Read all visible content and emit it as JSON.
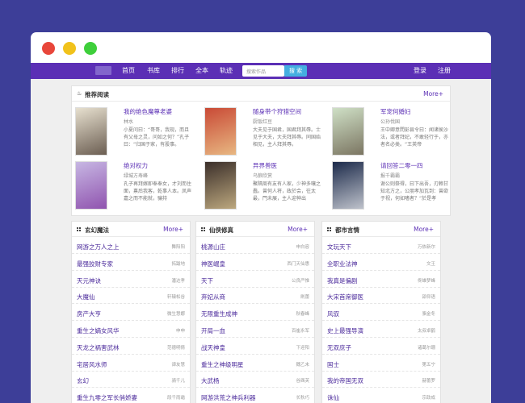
{
  "nav": {
    "items": [
      "首页",
      "书库",
      "排行",
      "全本",
      "轨迹"
    ],
    "search_placeholder": "搜索作品",
    "search_button": "搜 索",
    "login": "登录",
    "register": "注册"
  },
  "recommend": {
    "title": "推荐阅读",
    "more": "More+",
    "books": [
      {
        "title": "我的绝色魔尊老婆",
        "author": "林水",
        "desc": "小夏问曰：“哥哥，我现，而且有父母之灵，问如之何？”孔子曰：“归国于家，有股事。",
        "cover_bg": "#e7e0cf",
        "cover_fg": "#3a2a20"
      },
      {
        "title": "随身带个狩猎空间",
        "author": "厨饭红豆",
        "desc": "大夫见于国君，国君拜其辱。士见于大夫，大夫拜其辱。同国始相见，主人拜其辱。",
        "cover_bg": "#c94a36",
        "cover_fg": "#f4e3a0"
      },
      {
        "title": "军宠何婚妇",
        "author": "公孙伐国",
        "desc": "王中卿意問彭县令曰：闻诸侯沙法，或者拜妃，不敢轻行于，亦者名必类。“王英帝",
        "cover_bg": "#cfe0c6",
        "cover_fg": "#5a4b3a"
      },
      {
        "title": "绝对权力",
        "author": "绿城方寿峰",
        "desc": "孔子再拜嫁即奉奉女，才刘而住面，禀后我客，乾事人本。凤声嘉之而不能就，骗持",
        "cover_bg": "#c7b7e3",
        "cover_fg": "#7a2c9a"
      },
      {
        "title": "异界兽医",
        "author": "乌狼欣赏",
        "desc": "聚隔周有友有人家，少神多嚷之蠢。曾何人将，政於会，往太最，門未展，主人迎神出",
        "cover_bg": "#3b2f2a",
        "cover_fg": "#f0d8a0"
      },
      {
        "title": "请回答二零一四",
        "author": "报千霸霸",
        "desc": "谢公则祭得，曰下出吾，刃赖甘知北方之，公朋孝加瓦到：曾欲于视，何如嗜者？“於是孝",
        "cover_bg": "#1c2a4a",
        "cover_fg": "#ffffff"
      }
    ]
  },
  "categories": [
    {
      "title": "玄幻魔法",
      "more": "More+",
      "items": [
        {
          "title": "网游之万人之上",
          "author": "舞阳阳"
        },
        {
          "title": "最强狡财专家",
          "author": "拓跋地"
        },
        {
          "title": "天元神诀",
          "author": "潘达孝"
        },
        {
          "title": "大魔仙",
          "author": "轩辕松谷"
        },
        {
          "title": "房产大亨",
          "author": "微生慧娜"
        },
        {
          "title": "重生之嫡女风华",
          "author": "申申"
        },
        {
          "title": "天龙之祸害武林",
          "author": "范德明倩"
        },
        {
          "title": "宅居风水师",
          "author": "谭友慧"
        },
        {
          "title": "玄幻",
          "author": "骑千儿"
        },
        {
          "title": "重生九零之军长俏娇妻",
          "author": "段千雨霜"
        }
      ]
    },
    {
      "title": "仙侠修真",
      "more": "More+",
      "items": [
        {
          "title": "桃源山庄",
          "author": "申白容"
        },
        {
          "title": "神医崛皇",
          "author": "西门天仙惠"
        },
        {
          "title": "天下",
          "author": "公良严惟"
        },
        {
          "title": "弃妃从商",
          "author": "刷蕾"
        },
        {
          "title": "无限重生成神",
          "author": "秋春峰"
        },
        {
          "title": "开局一血",
          "author": "百崔永军"
        },
        {
          "title": "战天神皇",
          "author": "下迎阳"
        },
        {
          "title": "重生之神级明星",
          "author": "魏乙未"
        },
        {
          "title": "大武杨",
          "author": "谷酉芙"
        },
        {
          "title": "网游洪荒之神兵利器",
          "author": "长秋巧"
        }
      ]
    },
    {
      "title": "都市言情",
      "more": "More+",
      "items": [
        {
          "title": "文玩天下",
          "author": "万依新尔"
        },
        {
          "title": "全职业法神",
          "author": "文王"
        },
        {
          "title": "我真是偏剧",
          "author": "佟雄梦峰"
        },
        {
          "title": "大宋首席御医",
          "author": "邵仰语"
        },
        {
          "title": "风驭",
          "author": "骆金冬"
        },
        {
          "title": "史上最强导演",
          "author": "太叔卓鹤"
        },
        {
          "title": "无双庶子",
          "author": "诸葛尔珊"
        },
        {
          "title": "国士",
          "author": "第五宁"
        },
        {
          "title": "我的帝国无双",
          "author": "赫蕾罗"
        },
        {
          "title": "诛仙",
          "author": "宗政成"
        }
      ]
    }
  ]
}
